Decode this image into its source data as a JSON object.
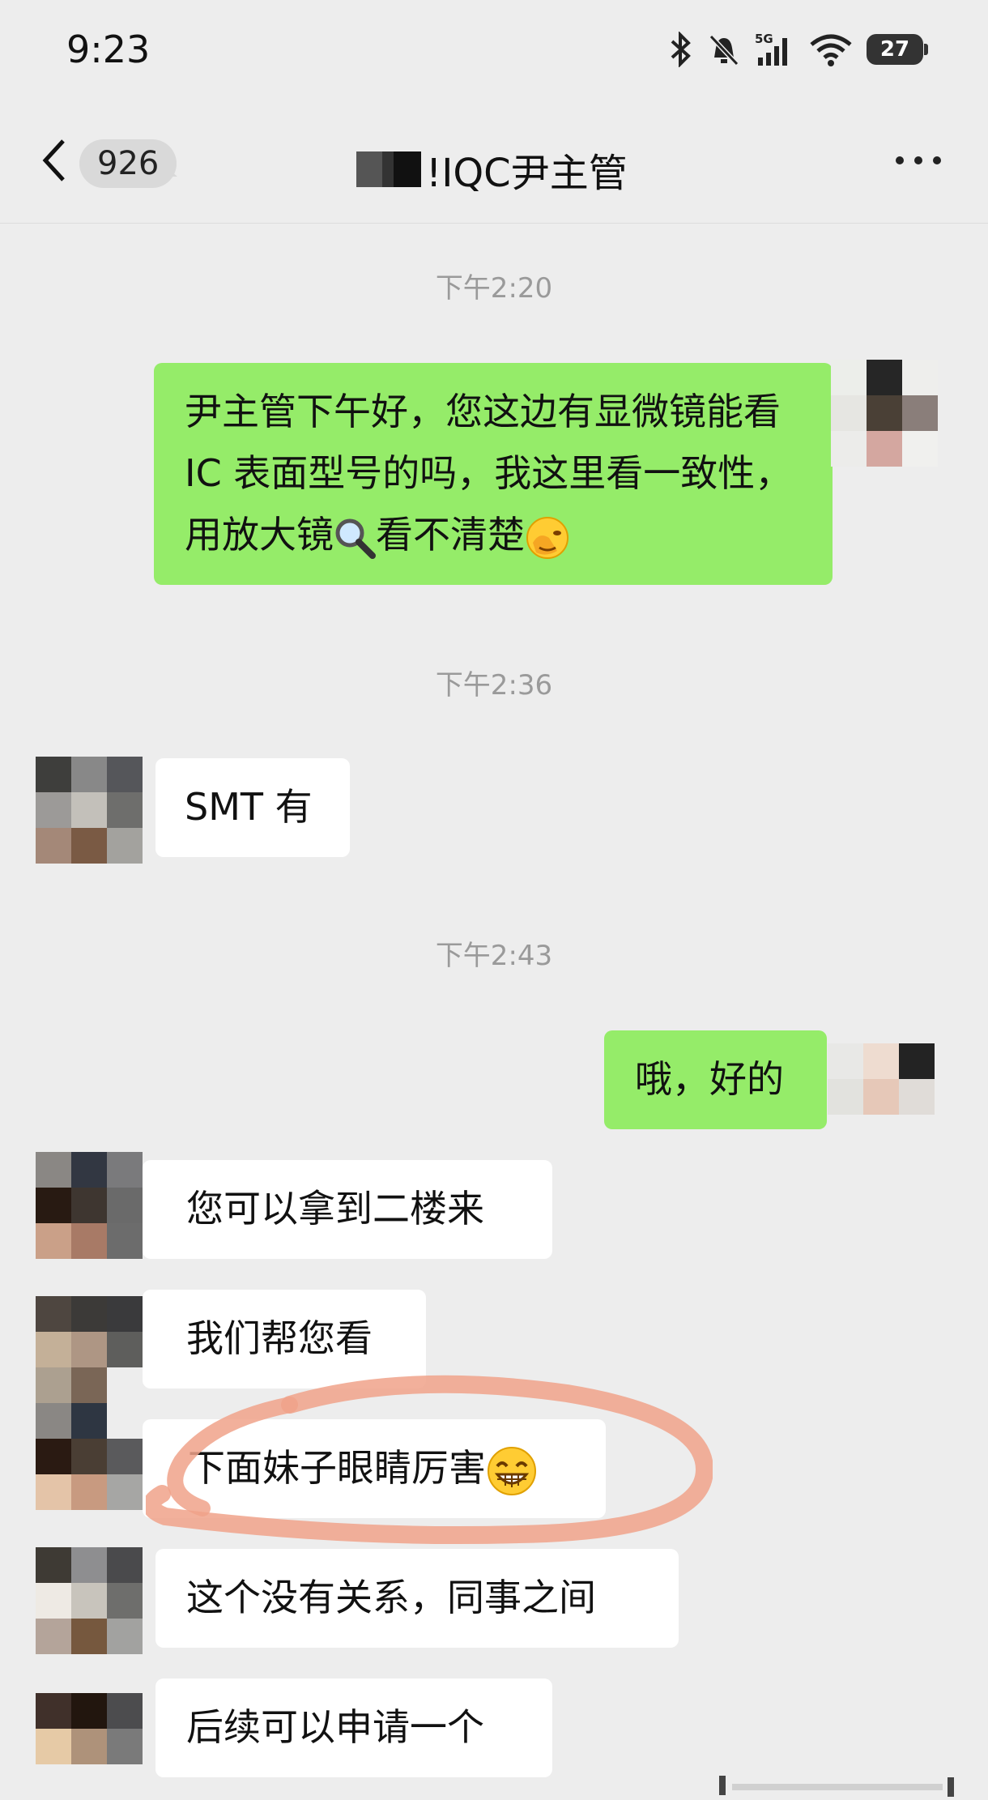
{
  "status_bar": {
    "time": "9:23",
    "battery": "27",
    "network": "5G"
  },
  "header": {
    "back_count": "926",
    "title": "!IQC尹主管"
  },
  "messages": {
    "ts1": "下午2:20",
    "m1": "尹主管下午好，您这边有显微镜能看 IC 表面型号的吗，我这里看一致性，用放大镜",
    "m1_tail": "看不清楚",
    "ts2": "下午2:36",
    "m2": "SMT 有",
    "ts3": "下午2:43",
    "m3": "哦，好的",
    "m4": "您可以拿到二楼来",
    "m5": "我们帮您看",
    "m6": "下面妹子眼睛厉害",
    "m7": "这个没有关系，同事之间",
    "m8": "后续可以申请一个"
  },
  "colors": {
    "outgoing_bubble": "#95ec69",
    "incoming_bubble": "#ffffff",
    "background": "#ededed",
    "highlight_circle": "#f0a28a"
  },
  "icons": [
    "bluetooth-icon",
    "mute-icon",
    "signal-icon",
    "wifi-icon",
    "battery-icon",
    "back-icon",
    "more-icon",
    "magnifier-emoji",
    "facepalm-emoji",
    "grin-emoji"
  ]
}
